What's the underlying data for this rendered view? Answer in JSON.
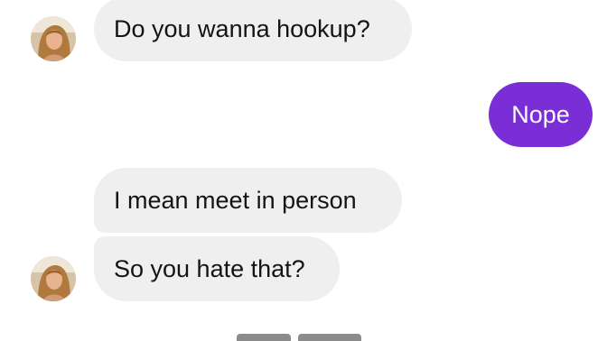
{
  "messages": [
    {
      "sender": "contact",
      "text": "Do you wanna hookup?"
    },
    {
      "sender": "me",
      "text": "Nope"
    },
    {
      "sender": "contact",
      "text": "I mean meet in person"
    },
    {
      "sender": "contact",
      "text": "So you hate that?"
    }
  ],
  "colors": {
    "incoming_bubble": "#efefef",
    "outgoing_bubble": "#7a2fd6",
    "incoming_text": "#141414",
    "outgoing_text": "#ffffff"
  },
  "icons": {
    "avatar": "contact-avatar-photo"
  }
}
